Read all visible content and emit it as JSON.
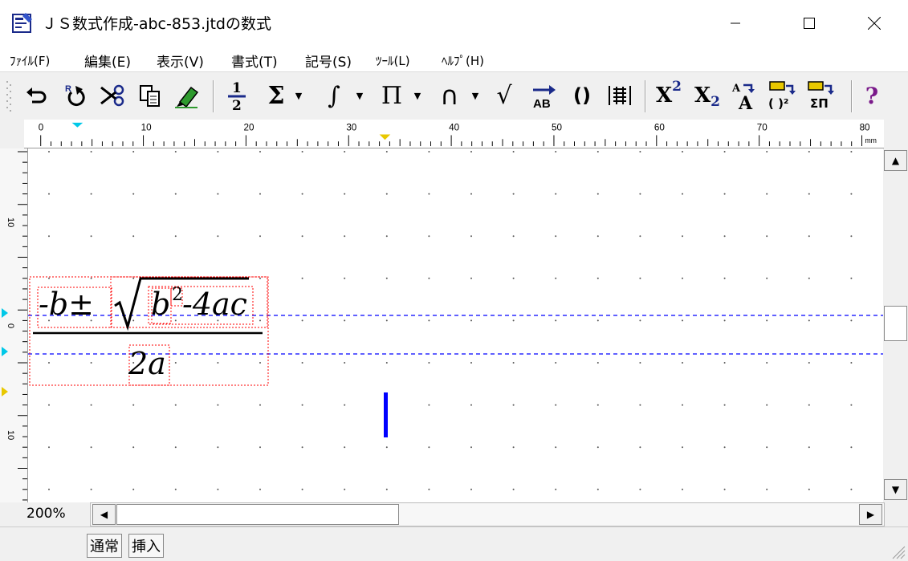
{
  "window": {
    "title": "ＪＳ数式作成-abc-853.jtdの数式"
  },
  "menu": [
    "ﾌｧｲﾙ(F)",
    "編集(E)",
    "表示(V)",
    "書式(T)",
    "記号(S)",
    "ﾂｰﾙ(L)",
    "ﾍﾙﾌﾟ(H)"
  ],
  "toolbar": {
    "fraction_icon": "fraction-icon",
    "sigma_label": "Σ",
    "integral_label": "∫",
    "pi_label": "Π",
    "cap_label": "∩",
    "sqrt_label": "√",
    "arrow_label": "AB",
    "paren_label": "()",
    "sup_label": "X",
    "sup_exp": "2",
    "sub_label": "X",
    "sub_exp": "2",
    "help_label": "?"
  },
  "ruler": {
    "h_labels": [
      "0",
      "10",
      "20",
      "30",
      "40",
      "50",
      "60",
      "70",
      "80"
    ],
    "unit": "mm",
    "v_labels": [
      "10",
      "0",
      "10"
    ]
  },
  "equation": {
    "numerator_left": "-b±",
    "radicand_b": "b",
    "radicand_exp": "2",
    "radicand_rest": "-4ac",
    "denominator": "2a"
  },
  "status": {
    "zoom": "200%"
  },
  "modes": {
    "normal": "通常",
    "insert": "挿入"
  },
  "colors": {
    "guide": "#0000ff",
    "box": "#ff0000",
    "cursor": "#0000ff",
    "marker_cyan": "#00c8e8",
    "marker_yellow": "#e8c800"
  }
}
